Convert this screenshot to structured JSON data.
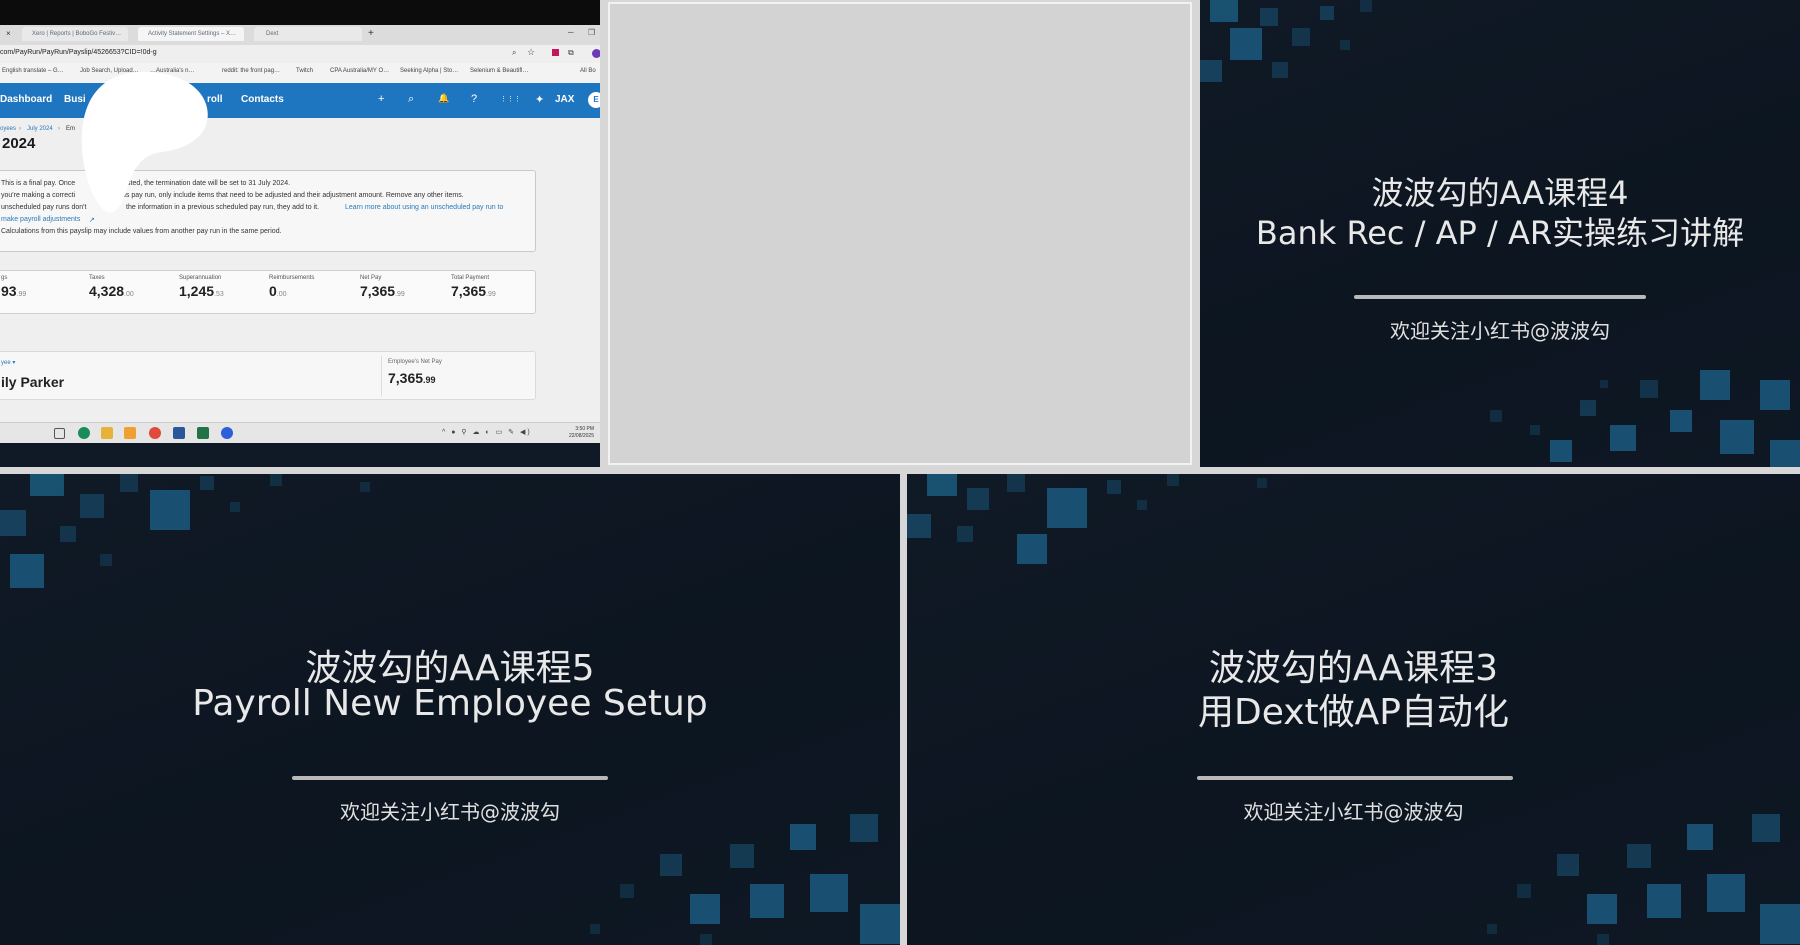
{
  "browser": {
    "tabs": [
      "Xero | Reports | BoboGo Festiv…",
      "Activity Statement Settings – X…",
      "Dext"
    ],
    "tab_close": "×",
    "new_tab": "+",
    "url": "com/PayRun/PayRun/Payslip/4526653?CID=!0d-g",
    "bookmarks": [
      "English translate – G…",
      "Job Search, Upload…",
      "…Australia's n…",
      "reddit: the front pag…",
      "Twitch",
      "CPA Australia/MY O…",
      "Seeking Alpha | Sto…",
      "Selenium & Beautifl…",
      "All Bo"
    ],
    "nav": {
      "items": [
        "Dashboard",
        "Busi",
        "roll",
        "Contacts"
      ],
      "icons": [
        "+",
        "⌕",
        "🔔",
        "?",
        "⋮⋮⋮"
      ],
      "jax": "JAX",
      "avatar": "E"
    },
    "breadcrumb": [
      "oyees",
      "July 2024",
      "Em"
    ],
    "page_title": "2024",
    "notice_lines": [
      "This is a final pay. Once",
      "sted, the termination date will be set to 31 July 2024.",
      "you're making a correcti",
      "us pay run, only include items that need to be adjusted and their adjustment amount. Remove any other items.",
      "unscheduled pay runs don't",
      "the information in a previous scheduled pay run, they add to it.",
      "Learn more about using an unscheduled pay run to",
      "make payroll adjustments",
      "Calculations from this payslip may include values from another pay run in the same period."
    ],
    "stats": [
      {
        "label": "gs",
        "value": "93",
        "cents": ".99"
      },
      {
        "label": "Taxes",
        "value": "4,328",
        "cents": ".00"
      },
      {
        "label": "Superannuation",
        "value": "1,245",
        "cents": ".53"
      },
      {
        "label": "Reimbursements",
        "value": "0",
        "cents": ".00"
      },
      {
        "label": "Net Pay",
        "value": "7,365",
        "cents": ".99"
      },
      {
        "label": "Total Payment",
        "value": "7,365",
        "cents": ".99"
      }
    ],
    "employee_select": "yee ▾",
    "employee_name": "ily Parker",
    "net_pay_label": "Employee's Net Pay",
    "net_pay_value": "7,365",
    "net_pay_cents": ".99",
    "tray_time": "3:50 PM",
    "tray_date": "22/08/2025"
  },
  "slides": {
    "course4": {
      "title_line1": "波波勾的AA课程4",
      "title_line2": "Bank Rec / AP / AR实操练习讲解",
      "subtitle": "欢迎关注小红书@波波勾"
    },
    "course5": {
      "title_line1": "波波勾的AA课程5",
      "title_line2": "Payroll New Employee Setup",
      "subtitle": "欢迎关注小红书@波波勾"
    },
    "course3": {
      "title_line1": "波波勾的AA课程3",
      "title_line2": "用Dext做AP自动化",
      "subtitle": "欢迎关注小红书@波波勾"
    }
  },
  "colors": {
    "xero_blue": "#1f76c0",
    "slide_bg": "#0c1520",
    "deco_blue": "#1c5b80"
  }
}
